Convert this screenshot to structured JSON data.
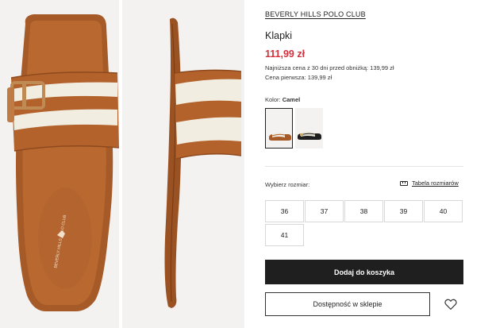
{
  "product": {
    "brand": "BEVERLY HILLS POLO CLUB",
    "title": "Klapki",
    "price": "111,99 zł",
    "lowest_price_note": "Najniższa cena z 30 dni przed obniżką: 139,99 zł",
    "original_price_note": "Cena pierwsza: 139,99 zł",
    "insole_logo_text": "BEVERLY HILLS POLO CLUB"
  },
  "color": {
    "label": "Kolor:",
    "value": "Camel",
    "swatches": [
      {
        "name": "Camel",
        "selected": true
      },
      {
        "name": "Black",
        "selected": false
      }
    ]
  },
  "sizes": {
    "label": "Wybierz rozmiar:",
    "table_link": "Tabela rozmiarów",
    "options": [
      "36",
      "37",
      "38",
      "39",
      "40",
      "41"
    ]
  },
  "actions": {
    "add_to_cart": "Dodaj do koszyka",
    "in_store": "Dostępność w sklepie"
  },
  "colors": {
    "price": "#d62e3b",
    "primary_button": "#1f1f1f",
    "leather": "#b5662f",
    "stripe": "#f1ede1"
  }
}
